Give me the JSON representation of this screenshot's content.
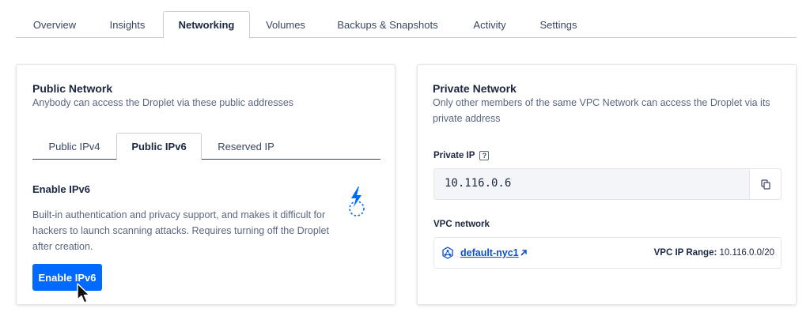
{
  "top_tabs": [
    "Overview",
    "Insights",
    "Networking",
    "Volumes",
    "Backups & Snapshots",
    "Activity",
    "Settings"
  ],
  "public_network": {
    "title": "Public Network",
    "subtitle": "Anybody can access the Droplet via these public addresses",
    "tabs": [
      "Public IPv4",
      "Public IPv6",
      "Reserved IP"
    ],
    "enable_title": "Enable IPv6",
    "description": "Built-in authentication and privacy support, and makes it difficult for hackers to launch scanning attacks. Requires turning off the Droplet after creation.",
    "button_label": "Enable IPv6"
  },
  "private_network": {
    "title": "Private Network",
    "subtitle": "Only other members of the same VPC Network can access the Droplet via its private address",
    "private_ip_label": "Private IP",
    "help_glyph": "?",
    "private_ip": "10.116.0.6",
    "vpc_label": "VPC network",
    "vpc_name": "default-nyc1",
    "vpc_range_label": "VPC IP Range:",
    "vpc_range": "10.116.0.0/20"
  },
  "colors": {
    "accent": "#0069ff",
    "link": "#0b4fc6",
    "text_dark": "#1b2640",
    "text_muted": "#5a667f"
  }
}
